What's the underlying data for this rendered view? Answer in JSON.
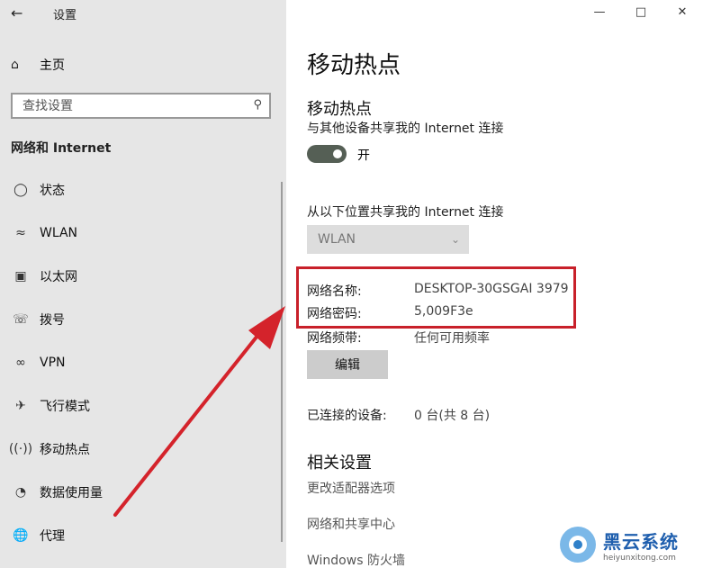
{
  "window": {
    "title": "设置",
    "back_icon": "back-arrow-icon",
    "controls": [
      "minimize",
      "maximize",
      "close"
    ]
  },
  "sidebar": {
    "home_label": "主页",
    "search_placeholder": "查找设置",
    "section_title": "网络和 Internet",
    "items": [
      {
        "label": "状态",
        "icon": "globe-icon"
      },
      {
        "label": "WLAN",
        "icon": "wifi-icon"
      },
      {
        "label": "以太网",
        "icon": "ethernet-icon"
      },
      {
        "label": "拨号",
        "icon": "dialup-icon"
      },
      {
        "label": "VPN",
        "icon": "vpn-icon"
      },
      {
        "label": "飞行模式",
        "icon": "airplane-icon"
      },
      {
        "label": "移动热点",
        "icon": "hotspot-icon"
      },
      {
        "label": "数据使用量",
        "icon": "data-usage-icon"
      },
      {
        "label": "代理",
        "icon": "proxy-globe-icon"
      }
    ]
  },
  "main": {
    "page_title": "移动热点",
    "hotspot_heading": "移动热点",
    "share_desc": "与其他设备共享我的 Internet 连接",
    "toggle_state": "开",
    "share_from_label": "从以下位置共享我的 Internet 连接",
    "share_from_value": "WLAN",
    "network_name_label": "网络名称:",
    "network_name_value": "DESKTOP-30GSGAI 3979",
    "network_password_label": "网络密码:",
    "network_password_value": "5,009F3e",
    "network_band_label": "网络频带:",
    "network_band_value": "任何可用频率",
    "edit_label": "编辑",
    "connected_label": "已连接的设备:",
    "connected_value": "0 台(共 8 台)",
    "related_heading": "相关设置",
    "related_links": [
      "更改适配器选项",
      "网络和共享中心",
      "Windows 防火墙"
    ]
  },
  "watermark": {
    "main": "黑云系统",
    "sub": "heiyunxitong.com"
  },
  "colors": {
    "highlight": "#c8202a",
    "toggle_on": "#555f55",
    "sidebar_bg": "#e6e6e6"
  }
}
